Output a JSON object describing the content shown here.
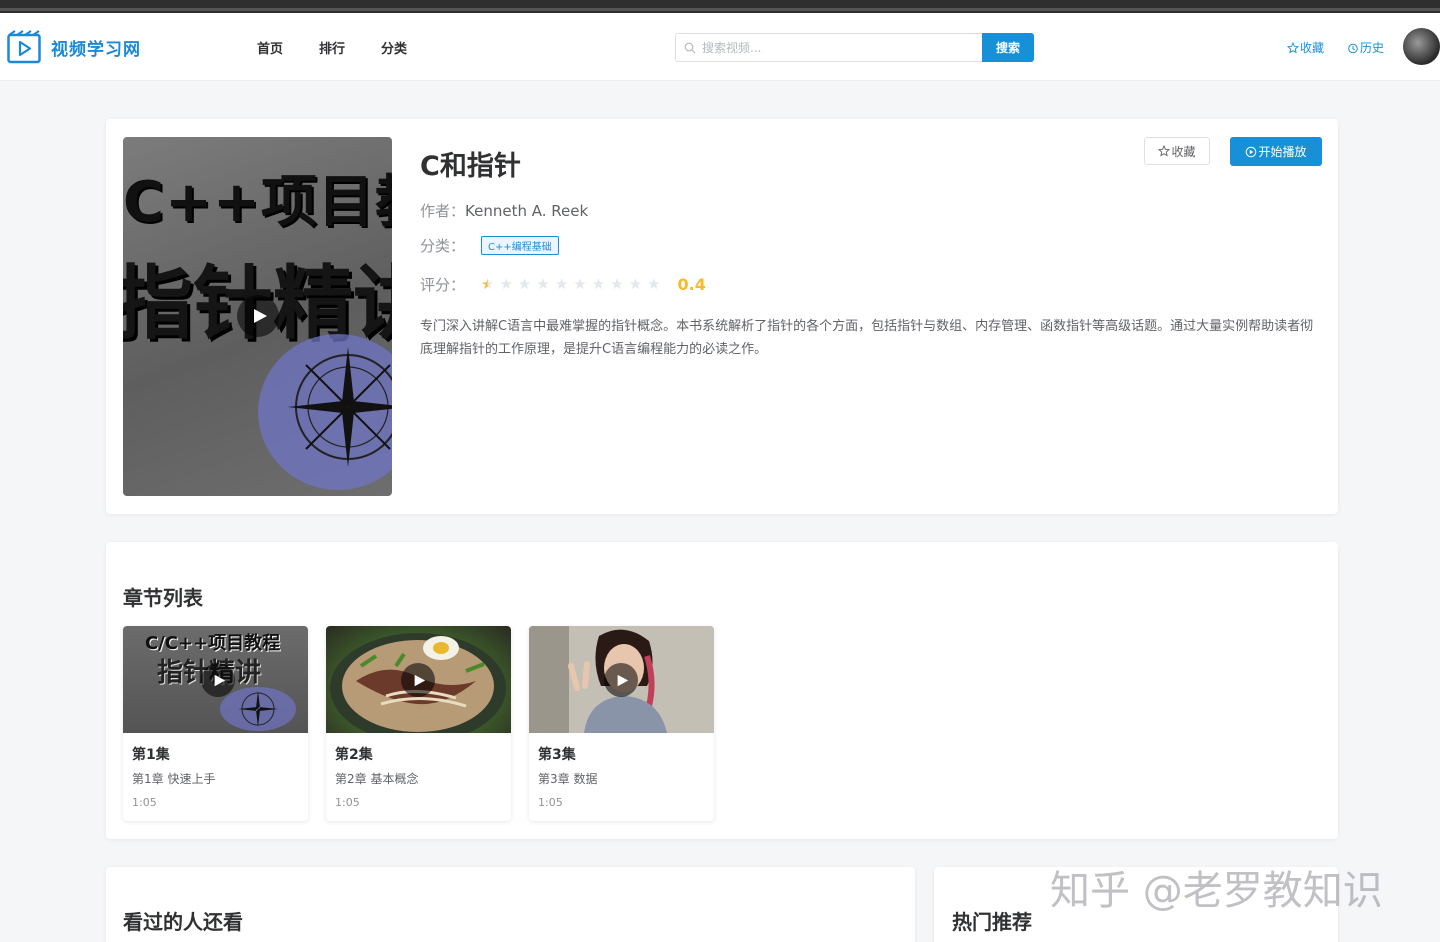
{
  "app": {
    "name": "视频学习网"
  },
  "nav": {
    "items": [
      "首页",
      "排行",
      "分类"
    ]
  },
  "search": {
    "placeholder": "搜索视频...",
    "button": "搜索"
  },
  "header_links": {
    "favorites": "收藏",
    "history": "历史"
  },
  "detail": {
    "cover_text_line1": "C++项目教",
    "cover_text_line2": "指针精讲",
    "title": "C和指针",
    "author_label": "作者：",
    "author": "Kenneth A. Reek",
    "category_label": "分类：",
    "category": "C++编程基础",
    "rating_label": "评分：",
    "rating": 0.4,
    "rating_text": "0.4",
    "rating_max": 10,
    "description": "专门深入讲解C语言中最难掌握的指针概念。本书系统解析了指针的各个方面，包括指针与数组、内存管理、函数指针等高级话题。通过大量实例帮助读者彻底理解指针的工作原理，是提升C语言编程能力的必读之作。",
    "fav_button": "收藏",
    "play_button": "开始播放"
  },
  "chapters": {
    "title": "章节列表",
    "items": [
      {
        "title": "第1集",
        "subtitle": "第1章 快速上手",
        "duration": "1:05",
        "thumb_text1": "C/C++项目教程",
        "thumb_text2": "指针精讲"
      },
      {
        "title": "第2集",
        "subtitle": "第2章 基本概念",
        "duration": "1:05"
      },
      {
        "title": "第3集",
        "subtitle": "第3章 数据",
        "duration": "1:05"
      }
    ]
  },
  "also_watched": {
    "title": "看过的人还看"
  },
  "hot": {
    "title": "热门推荐"
  },
  "watermark": "知乎 @老罗教知识",
  "colors": {
    "accent": "#1890d8",
    "star": "#f7ba2a",
    "background": "#f5f6f8"
  },
  "icons": [
    "search-icon",
    "star-icon",
    "clock-icon",
    "play-icon",
    "play-circle-icon",
    "logo-icon"
  ]
}
